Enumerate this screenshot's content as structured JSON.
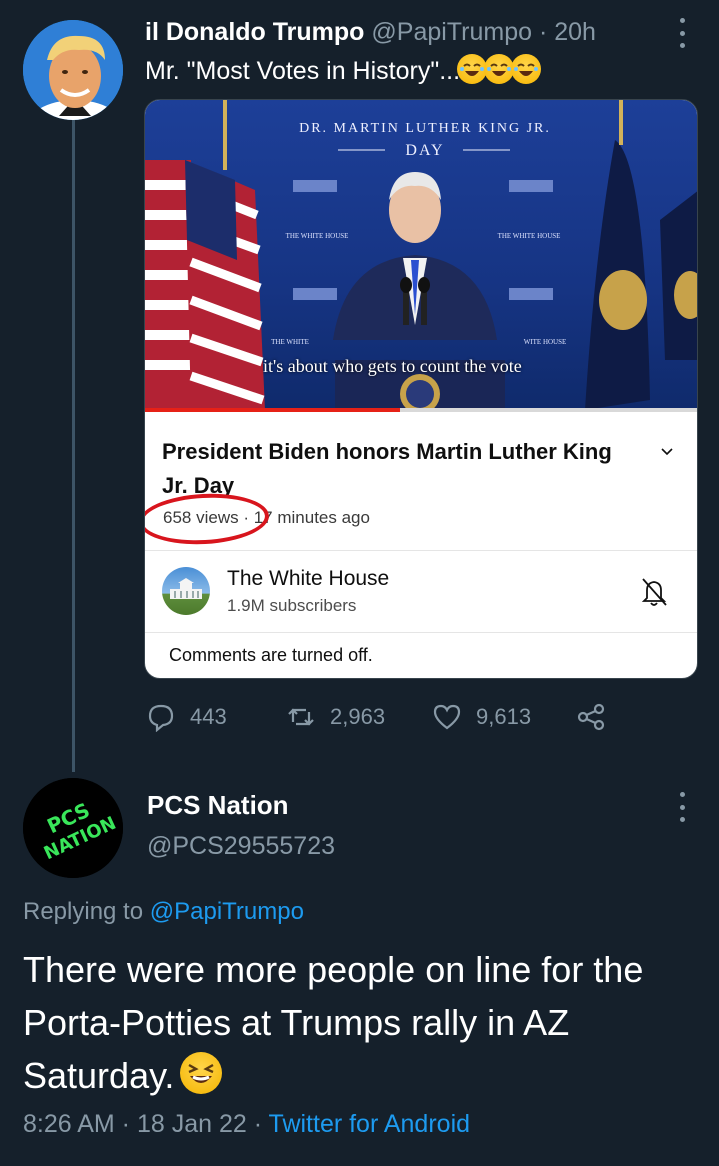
{
  "tweet": {
    "name": "il Donaldo Trumpo",
    "handle": "@PapiTrumpo",
    "separator": " · ",
    "time": "20h",
    "text": "Mr. \"Most Votes in History\"...",
    "emoji_count": 3,
    "embed": {
      "video_banner_top": "Dr. Martin Luther King Jr.",
      "video_banner_bottom": "DAY",
      "podium_left": "THE WHITE HOUSE",
      "podium_right": "THE WHITE HOUSE",
      "podium_left_lower": "THE WHITE",
      "podium_right_lower": "WHITE HOUSE",
      "caption": "it's about who gets to count the vote",
      "progress": 0.46,
      "title": "President Biden honors Martin Luther King Jr. Day",
      "views": "658 views",
      "meta_sep": " · ",
      "age": "17 minutes ago",
      "channel_name": "The White House",
      "subscribers": "1.9M subscribers",
      "comments_notice": "Comments are turned off."
    },
    "actions": {
      "replies": "443",
      "retweets": "2,963",
      "likes": "9,613"
    }
  },
  "reply": {
    "name": "PCS Nation",
    "handle": "@PCS29555723",
    "avatar_text_1": "PCS",
    "avatar_text_2": "NATION",
    "replying_prefix": "Replying to ",
    "replying_to": "@PapiTrumpo",
    "body": "There were more people on line for the Porta-Potties at Trumps rally in AZ Saturday.",
    "time": "8:26 AM",
    "date": "18 Jan 22",
    "meta_sep": " · ",
    "client": "Twitter for Android"
  },
  "colors": {
    "background": "#15202b",
    "secondary_text": "#8899a6",
    "link": "#1d9bf0",
    "annotation_red": "#d8151d"
  }
}
